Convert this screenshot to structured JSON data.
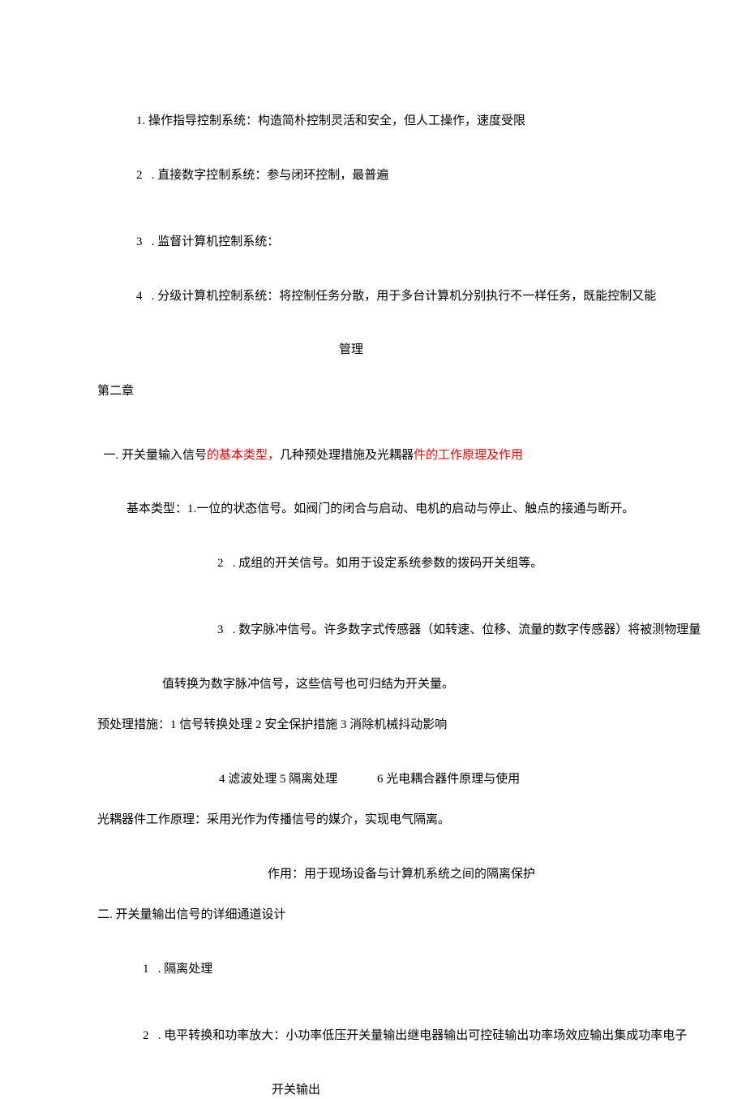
{
  "lines": {
    "l1": "1. 操作指导控制系统：构造简朴控制灵活和安全，但人工操作，速度受限",
    "l2": "2   . 直接数字控制系统：参与闭环控制，最普遍",
    "l3": "3   . 监督计算机控制系统：",
    "l4": "4   . 分级计算机控制系统：将控制任务分散，用于多台计算机分别执行不一样任务，既能控制又能",
    "l5": "管理",
    "l6": "第二章",
    "l7a": "一. 开关量输入信号",
    "l7b": "的基本类型，",
    "l7c": "几种预处理措施及光耦器",
    "l7d": "件的工作原理及作用",
    "l8": "基本类型：1.一位的状态信号。如阀门的闭合与启动、电机的启动与停止、触点的接通与断开。",
    "l9": "2   . 成组的开关信号。如用于设定系统参数的拨码开关组等。",
    "l10": "3   . 数字脉冲信号。许多数字式传感器（如转速、位移、流量的数字传感器）将被测物理量",
    "l11": "值转换为数字脉冲信号，这些信号也可归结为开关量。",
    "l12": "预处理措施：1 信号转换处理 2 安全保护措施 3 消除机械抖动影响",
    "l13": "4 滤波处理 5 隔离处理             6 光电耦合器件原理与使用",
    "l14": "光耦器件工作原理：采用光作为传播信号的媒介，实现电气隔离。",
    "l15": "作用：用于现场设备与计算机系统之间的隔离保护",
    "l16": "二. 开关量输出信号的详细通道设计",
    "l17": "1   . 隔离处理",
    "l18": "2   . 电平转换和功率放大：小功率低压开关量输出继电器输出可控硅输出功率场效应输出集成功率电子",
    "l19": "开关输出"
  }
}
